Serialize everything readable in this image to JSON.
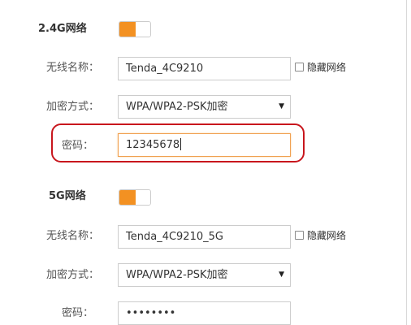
{
  "wifi_2g": {
    "title": "2.4G网络",
    "enabled": true,
    "ssid_label": "无线名称：",
    "ssid_value": "Tenda_4C9210",
    "hide_label": "隐藏网络",
    "security_label": "加密方式：",
    "security_value": "WPA/WPA2-PSK加密",
    "password_label": "密码：",
    "password_value": "12345678"
  },
  "wifi_5g": {
    "title": "5G网络",
    "enabled": true,
    "ssid_label": "无线名称：",
    "ssid_value": "Tenda_4C9210_5G",
    "hide_label": "隐藏网络",
    "security_label": "加密方式：",
    "security_value": "WPA/WPA2-PSK加密",
    "password_label": "密码：",
    "password_value": "••••••••"
  },
  "icons": {
    "dropdown": "triangle-down",
    "annotation": "red-rounded-highlight"
  },
  "colors": {
    "toggle_on": "#f39122",
    "highlight": "#c8161d"
  }
}
